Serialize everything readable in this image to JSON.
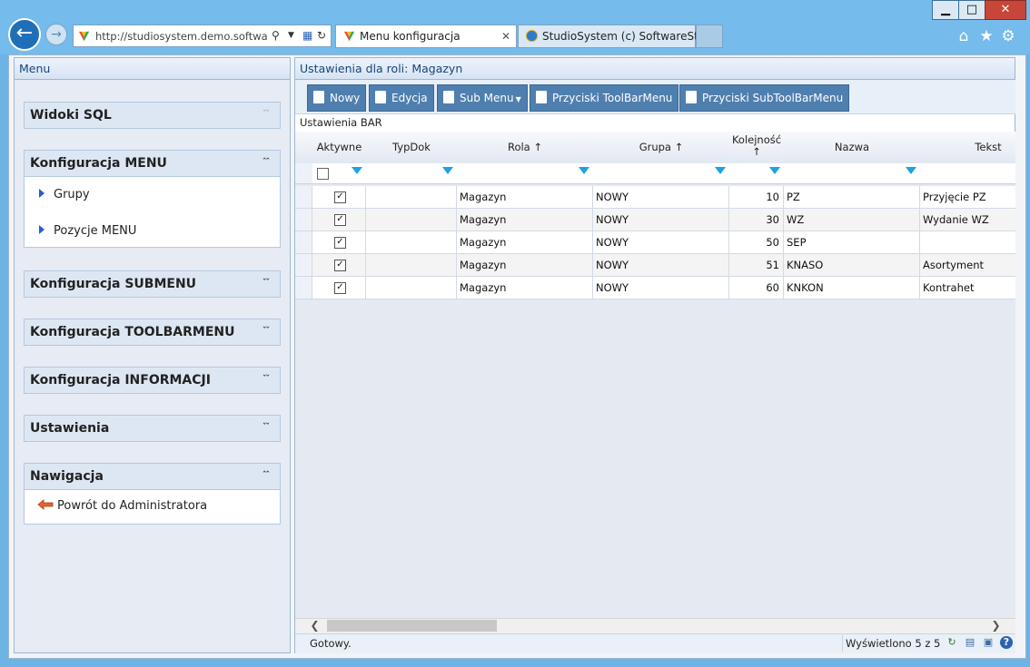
{
  "window": {
    "minimize": "▁",
    "maximize": "□",
    "close": "✕"
  },
  "browser": {
    "address": "http://studiosystem.demo.softwar...",
    "tabs": [
      {
        "label": "Menu konfiguracja",
        "close": "✕"
      },
      {
        "label": "StudioSystem (c) SoftwareStud..."
      }
    ],
    "icons": {
      "back": "back-arrow-icon",
      "forward": "forward-arrow-icon",
      "home": "home-icon",
      "favorites": "star-icon",
      "settings": "gear-icon"
    }
  },
  "menu": {
    "title": "Menu",
    "groups": [
      {
        "title": "Widoki SQL",
        "state": "collapsed"
      },
      {
        "title": "Konfiguracja MENU",
        "state": "expanded",
        "items": [
          "Grupy",
          "Pozycje MENU"
        ]
      },
      {
        "title": "Konfiguracja SUBMENU",
        "state": "collapsed"
      },
      {
        "title": "Konfiguracja TOOLBARMENU",
        "state": "collapsed"
      },
      {
        "title": "Konfiguracja INFORMACJI",
        "state": "collapsed"
      },
      {
        "title": "Ustawienia",
        "state": "collapsed"
      },
      {
        "title": "Nawigacja",
        "state": "expanded",
        "items": [
          "Powrót do Administratora"
        ]
      }
    ]
  },
  "main": {
    "title": "Ustawienia dla roli: Magazyn",
    "toolbar": {
      "nowy": "Nowy",
      "edycja": "Edycja",
      "submenu": "Sub Menu",
      "toolbar": "Przyciski ToolBarMenu",
      "subtoolbar": "Przyciski SubToolBarMenu"
    },
    "section": "Ustawienia BAR",
    "columns": {
      "aktywne": "Aktywne",
      "typdok": "TypDok",
      "rola": "Rola",
      "grupa": "Grupa",
      "kolejnosc": "Kolejność",
      "nazwa": "Nazwa",
      "tekst": "Tekst"
    },
    "rows": [
      {
        "aktywne": true,
        "typdok": "",
        "rola": "Magazyn",
        "grupa": "NOWY",
        "kolejnosc": "10",
        "nazwa": "PZ",
        "tekst": "Przyjęcie PZ"
      },
      {
        "aktywne": true,
        "typdok": "",
        "rola": "Magazyn",
        "grupa": "NOWY",
        "kolejnosc": "30",
        "nazwa": "WZ",
        "tekst": "Wydanie WZ"
      },
      {
        "aktywne": true,
        "typdok": "",
        "rola": "Magazyn",
        "grupa": "NOWY",
        "kolejnosc": "50",
        "nazwa": "SEP",
        "tekst": ""
      },
      {
        "aktywne": true,
        "typdok": "",
        "rola": "Magazyn",
        "grupa": "NOWY",
        "kolejnosc": "51",
        "nazwa": "KNASO",
        "tekst": "Asortyment"
      },
      {
        "aktywne": true,
        "typdok": "",
        "rola": "Magazyn",
        "grupa": "NOWY",
        "kolejnosc": "60",
        "nazwa": "KNKON",
        "tekst": "Kontrahet"
      }
    ],
    "status": "Gotowy.",
    "count": "Wyświetlono 5 z 5"
  },
  "colors": {
    "chrome": "#75bbec",
    "toolbar_button": "#4f7fae",
    "header_text": "#17457a",
    "filter_icon": "#1ea2e0"
  }
}
